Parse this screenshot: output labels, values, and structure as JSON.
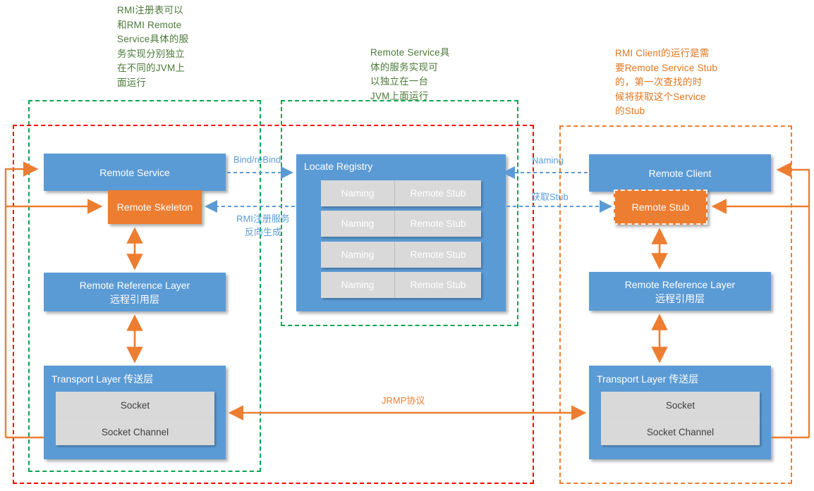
{
  "notes": [
    {
      "id": "note-jvm-separation",
      "color": "#4d7a3a",
      "text": "RMI注册表可以\n和RMI Remote\nService具体的服\n务实现分别独立\n在不同的JVM上\n面运行"
    },
    {
      "id": "note-remote-service-jvm",
      "color": "#4d7a3a",
      "text": "Remote Service具\n体的服务实现可\n以独立在一台\nJVM上面运行"
    },
    {
      "id": "note-rmi-client-stub",
      "color": "#e0761f",
      "text": "RMI Client的运行是需\n要Remote Service Stub\n的，第一次查找的时\n候将获取这个Service\n的Stub"
    }
  ],
  "server": {
    "remote_service": "Remote Service",
    "remote_skeleton": "Remote Skeleton",
    "reference_layer": {
      "en": "Remote Reference Layer",
      "zh": "远程引用层"
    },
    "transport_layer": {
      "title": "Transport Layer 传送层",
      "socket": "Socket",
      "socket_channel": "Socket Channel"
    }
  },
  "registry": {
    "title": "Locate Registry",
    "rows": [
      {
        "naming": "Naming",
        "stub": "Remote Stub"
      },
      {
        "naming": "Naming",
        "stub": "Remote Stub"
      },
      {
        "naming": "Naming",
        "stub": "Remote Stub"
      },
      {
        "naming": "Naming",
        "stub": "Remote Stub"
      }
    ]
  },
  "client": {
    "remote_client": "Remote Client",
    "remote_stub": "Remote Stub",
    "reference_layer": {
      "en": "Remote Reference Layer",
      "zh": "远程引用层"
    },
    "transport_layer": {
      "title": "Transport Layer 传送层",
      "socket": "Socket",
      "socket_channel": "Socket Channel"
    }
  },
  "connectors": {
    "bind_rebind": "Bind/reBind",
    "rmi_reverse_gen": "RMI注册服务\n反向生成",
    "naming": "Naming",
    "get_stub": "获取Stub",
    "jrmp": "JRMP协议"
  },
  "colors": {
    "blue": "#5b9bd5",
    "orange": "#ed7d31",
    "grey": "#d9d9d9",
    "green_dashed": "#00a651",
    "red_dashed": "#ff0000",
    "orange_dashed": "#ed7d31",
    "note_green": "#4d7a3a",
    "note_orange": "#e0761f",
    "label_blue": "#5b9bd5"
  }
}
